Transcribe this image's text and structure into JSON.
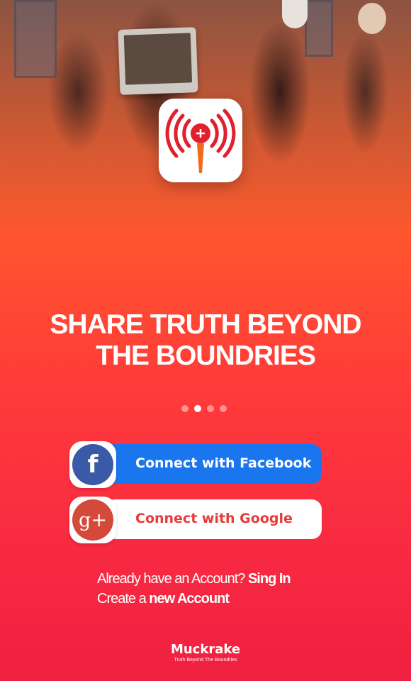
{
  "app": {
    "icon_name": "broadcast-microphone-icon",
    "brand_colors": {
      "primary": "#ff4a30",
      "mic": "#f26a1f",
      "waves": "#e0202e"
    }
  },
  "headline": {
    "line1": "SHARE TRUTH BEYOND",
    "line2": "THE BOUNDRIES"
  },
  "pager": {
    "count": 4,
    "active_index": 1
  },
  "buttons": {
    "facebook": {
      "label": "Connect with Facebook",
      "icon": "facebook-icon",
      "glyph": "f",
      "color": "#1976ee"
    },
    "google": {
      "label": "Connect with Google",
      "icon": "google-plus-icon",
      "glyph": "g+",
      "color": "#d3493a"
    }
  },
  "account": {
    "have_account_text": "Already have an Account?",
    "sign_in_label": "Sing In",
    "create_text": "Create a",
    "new_account_label": "new Account"
  },
  "footer": {
    "brand": "Muckrake",
    "tagline": "Truth Beyond The Boundries"
  }
}
